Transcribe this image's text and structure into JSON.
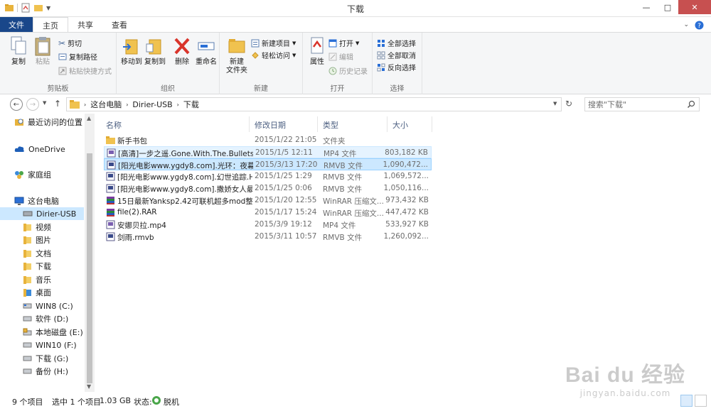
{
  "window": {
    "title": "下载",
    "minimize": "—",
    "maximize": "□",
    "close": "✕"
  },
  "ribbon_tabs": [
    {
      "label": "文件"
    },
    {
      "label": "主页"
    },
    {
      "label": "共享"
    },
    {
      "label": "查看"
    }
  ],
  "ribbon": {
    "clipboard": {
      "label": "剪贴板",
      "copy": "复制",
      "paste": "粘贴",
      "cut": "剪切",
      "copy_path": "复制路径",
      "paste_shortcut": "粘贴快捷方式"
    },
    "organize": {
      "label": "组织",
      "move_to": "移动到",
      "copy_to": "复制到",
      "delete": "删除",
      "rename": "重命名"
    },
    "new": {
      "label": "新建",
      "new_folder_line1": "新建",
      "new_folder_line2": "文件夹",
      "new_item": "新建项目",
      "easy_access": "轻松访问"
    },
    "open": {
      "label": "打开",
      "properties": "属性",
      "open": "打开",
      "edit": "编辑",
      "history": "历史记录"
    },
    "select": {
      "label": "选择",
      "select_all": "全部选择",
      "select_none": "全部取消",
      "invert": "反向选择"
    }
  },
  "address": {
    "crumbs": [
      "这台电脑",
      "Dirier-USB",
      "下载"
    ],
    "search_placeholder": "搜索\"下载\""
  },
  "nav": [
    {
      "label": "最近访问的位置",
      "icon": "recent-icon"
    },
    {
      "label": "OneDrive",
      "icon": "cloud-icon"
    },
    {
      "label": "家庭组",
      "icon": "homegroup-icon"
    },
    {
      "label": "这台电脑",
      "icon": "computer-icon"
    },
    {
      "label": "Dirier-USB",
      "icon": "drive-icon"
    },
    {
      "label": "视频",
      "icon": "folder-icon"
    },
    {
      "label": "图片",
      "icon": "folder-icon"
    },
    {
      "label": "文档",
      "icon": "folder-icon"
    },
    {
      "label": "下载",
      "icon": "folder-icon"
    },
    {
      "label": "音乐",
      "icon": "folder-icon"
    },
    {
      "label": "桌面",
      "icon": "folder-icon"
    },
    {
      "label": "WIN8 (C:)",
      "icon": "drive-icon"
    },
    {
      "label": "软件 (D:)",
      "icon": "drive-icon"
    },
    {
      "label": "本地磁盘 (E:)",
      "icon": "drive-icon"
    },
    {
      "label": "WIN10 (F:)",
      "icon": "drive-icon"
    },
    {
      "label": "下载 (G:)",
      "icon": "drive-icon"
    },
    {
      "label": "备份 (H:)",
      "icon": "drive-icon"
    }
  ],
  "columns": {
    "name": "名称",
    "date": "修改日期",
    "type": "类型",
    "size": "大小"
  },
  "files": [
    {
      "name": "新手书包",
      "date": "2015/1/22 21:05",
      "type": "文件夹",
      "size": "",
      "icon": "folder-icon"
    },
    {
      "name": "[高清]一步之遥.Gone.With.The.Bullets....",
      "date": "2015/1/5 12:11",
      "type": "MP4 文件",
      "size": "803,182 KB",
      "icon": "video-icon"
    },
    {
      "name": "[阳光电影www.ygdy8.com].光环：夜幕....",
      "date": "2015/3/13 17:20",
      "type": "RMVB 文件",
      "size": "1,090,472...",
      "icon": "video-icon"
    },
    {
      "name": "[阳光电影www.ygdy8.com].幻世追踪.H...",
      "date": "2015/1/25 1:29",
      "type": "RMVB 文件",
      "size": "1,069,572...",
      "icon": "video-icon"
    },
    {
      "name": "[阳光电影www.ygdy8.com].撒娇女人最...",
      "date": "2015/1/25 0:06",
      "type": "RMVB 文件",
      "size": "1,050,116...",
      "icon": "video-icon"
    },
    {
      "name": "15日最新Yanksp2.42可联机超多mod整...",
      "date": "2015/1/20 12:55",
      "type": "WinRAR 压缩文...",
      "size": "973,432 KB",
      "icon": "archive-icon"
    },
    {
      "name": "file(2).RAR",
      "date": "2015/1/17 15:24",
      "type": "WinRAR 压缩文...",
      "size": "447,472 KB",
      "icon": "archive-icon"
    },
    {
      "name": "安娜贝拉.mp4",
      "date": "2015/3/9 19:12",
      "type": "MP4 文件",
      "size": "533,927 KB",
      "icon": "video-icon"
    },
    {
      "name": "剑雨.rmvb",
      "date": "2015/3/11 10:57",
      "type": "RMVB 文件",
      "size": "1,260,092...",
      "icon": "video-icon"
    }
  ],
  "status": {
    "count": "9 个项目",
    "selected": "选中 1 个项目",
    "selected_size": "1.03 GB",
    "state_label": "状态:",
    "state_value": "脱机"
  },
  "watermark": {
    "brand": "Bai du 经验",
    "url": "jingyan.baidu.com"
  }
}
